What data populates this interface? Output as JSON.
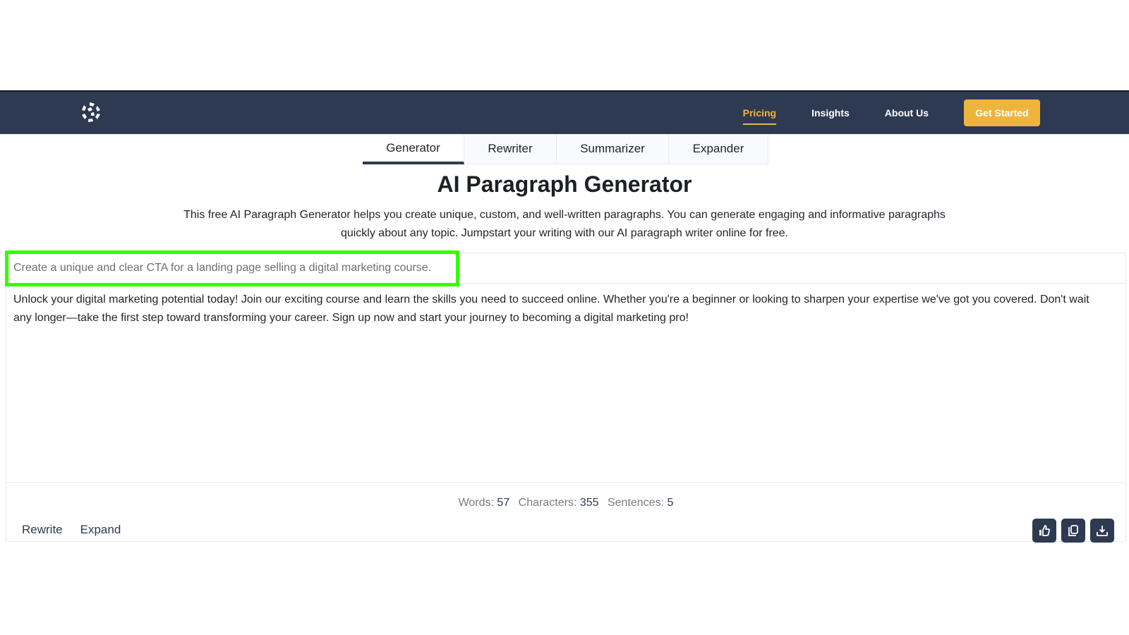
{
  "nav": {
    "logo": "logo-icon",
    "links": [
      {
        "label": "Pricing",
        "active": true
      },
      {
        "label": "Insights",
        "active": false
      },
      {
        "label": "About Us",
        "active": false
      }
    ],
    "cta_label": "Get Started"
  },
  "tabs": [
    {
      "label": "Generator",
      "active": true
    },
    {
      "label": "Rewriter",
      "active": false
    },
    {
      "label": "Summarizer",
      "active": false
    },
    {
      "label": "Expander",
      "active": false
    }
  ],
  "page": {
    "title": "AI Paragraph Generator",
    "description_line1": "This free AI Paragraph Generator helps you create unique, custom, and well-written paragraphs. You can generate engaging and informative paragraphs",
    "description_line2": "quickly about any topic. Jumpstart your writing with our AI paragraph writer online for free."
  },
  "editor": {
    "prompt_value": "Create a unique and clear CTA for a landing page selling a digital marketing course.",
    "output_text": "Unlock your digital marketing potential today! Join our exciting course and learn the skills you need to succeed online. Whether you're a beginner or looking to sharpen your expertise we've got you covered. Don't wait any longer—take the first step toward transforming your career. Sign up now and start your journey to becoming a digital marketing pro!",
    "highlight_color": "#33ff00"
  },
  "stats": {
    "words_label": "Words:",
    "words": "57",
    "characters_label": "Characters:",
    "characters": "355",
    "sentences_label": "Sentences:",
    "sentences": "5"
  },
  "actions": {
    "rewrite_label": "Rewrite",
    "expand_label": "Expand",
    "icons": [
      "thumbs-up-icon",
      "copy-icon",
      "download-icon"
    ]
  },
  "colors": {
    "navbar": "#2e3a52",
    "accent": "#efb43d"
  }
}
